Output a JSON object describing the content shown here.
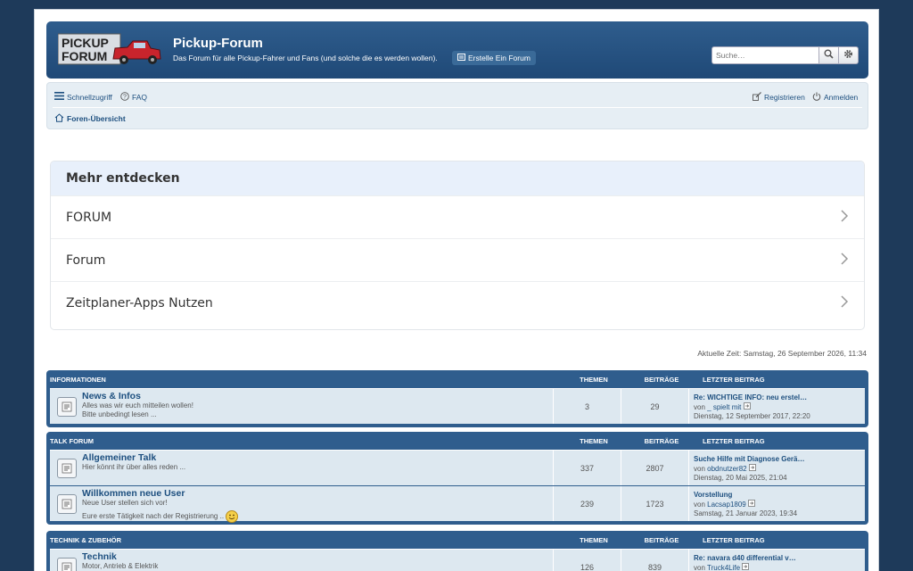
{
  "header": {
    "title": "Pickup-Forum",
    "description": "Das Forum für alle Pickup-Fahrer und Fans (und solche die es werden wollen).",
    "create_label": "Erstelle Ein Forum",
    "logo_line1": "PICKUP",
    "logo_line2": "FORUM"
  },
  "search": {
    "placeholder": "Suche…"
  },
  "navbar": {
    "quicklinks": "Schnellzugriff",
    "faq": "FAQ",
    "register": "Registrieren",
    "login": "Anmelden",
    "breadcrumb": "Foren-Übersicht"
  },
  "discover": {
    "title": "Mehr entdecken",
    "items": [
      "FORUM",
      "Forum",
      "Zeitplaner-Apps Nutzen"
    ]
  },
  "current_time": "Aktuelle Zeit: Samstag, 26 September 2026, 11:34",
  "columns": {
    "topics": "Themen",
    "posts": "Beiträge",
    "last_post": "Letzter Beitrag"
  },
  "categories": [
    {
      "name": "Informationen",
      "forums": [
        {
          "title": "News & Infos",
          "desc1": "Alles was wir euch mitteilen wollen!",
          "desc2": "Bitte unbedingt lesen ...",
          "topics": "3",
          "posts": "29",
          "last_title": "Re: WICHTIGE INFO: neu erstel…",
          "by": "von",
          "last_author": "_ spielt mit",
          "last_date": "Dienstag, 12 September 2017, 22:20"
        }
      ]
    },
    {
      "name": "Talk Forum",
      "forums": [
        {
          "title": "Allgemeiner Talk",
          "desc1": "Hier könnt ihr über alles reden ...",
          "desc2": "",
          "topics": "337",
          "posts": "2807",
          "last_title": "Suche Hilfe mit Diagnose Gerä…",
          "by": "von",
          "last_author": "obdnutzer82",
          "last_date": "Dienstag, 20 Mai 2025, 21:04"
        },
        {
          "title": "Willkommen neue User",
          "desc1": "Neue User stellen sich vor!",
          "desc2": "Eure erste Tätigkeit nach der Registrierung ..",
          "topics": "239",
          "posts": "1723",
          "last_title": "Vorstellung",
          "by": "von",
          "last_author": "Lacsap1809",
          "last_date": "Samstag, 21 Januar 2023, 19:34"
        }
      ]
    },
    {
      "name": "Technik & Zubehör",
      "forums": [
        {
          "title": "Technik",
          "desc1": "Motor, Antrieb & Elektrik",
          "desc2": "",
          "topics": "126",
          "posts": "839",
          "last_title": "Re: navara d40 differential v…",
          "by": "von",
          "last_author": "Truck4Life",
          "last_date": ""
        }
      ]
    }
  ],
  "colors": {
    "header_bg": "#2f5d8d",
    "link": "#1d4f7f",
    "row_bg": "#dde8f0",
    "page_bg": "#1e3a5a"
  }
}
